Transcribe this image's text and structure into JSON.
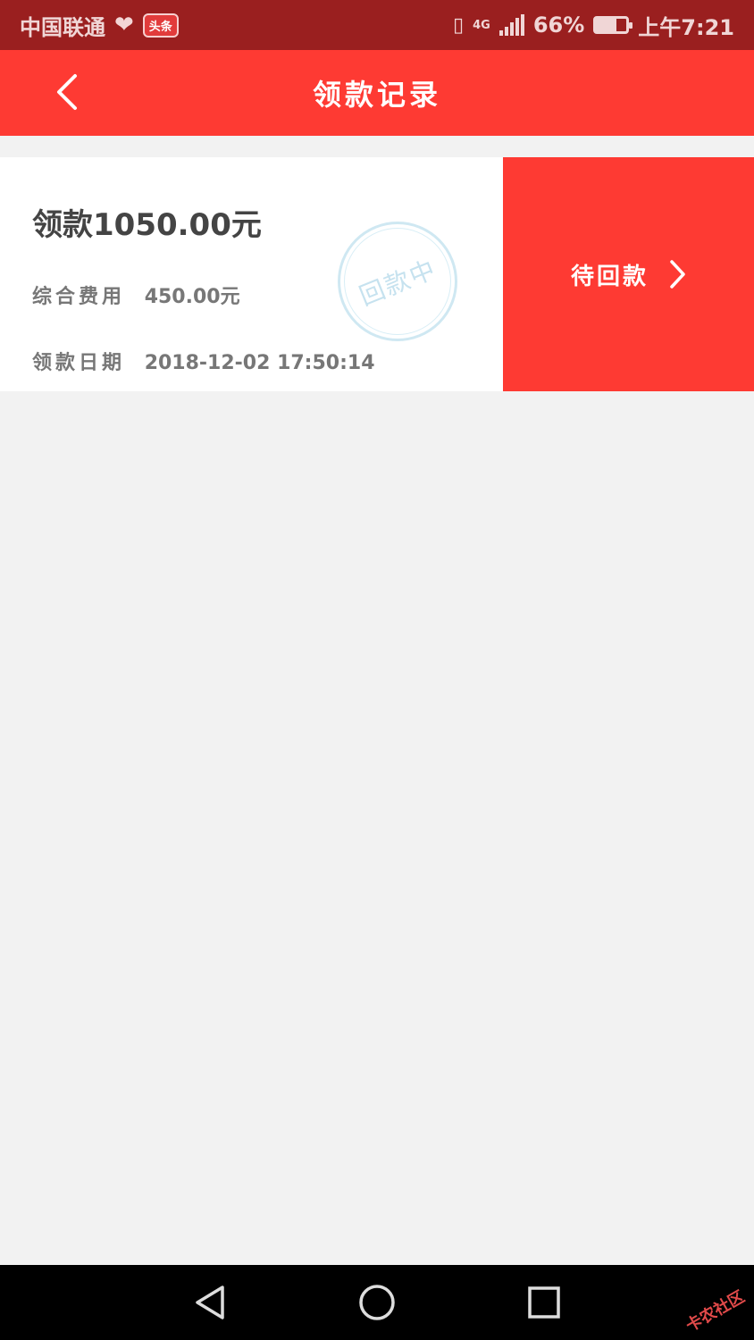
{
  "status_bar": {
    "carrier": "中国联通",
    "badge": "头条",
    "network": "4G",
    "battery": "66%",
    "battery_level": 0.66,
    "time": "上午7:21"
  },
  "header": {
    "title": "领款记录",
    "back_icon": "chevron-left-icon"
  },
  "record": {
    "amount": "领款1050.00元",
    "fee_label": "综合费用",
    "fee_value": "450.00元",
    "date_label": "领款日期",
    "date_value": "2018-12-02 17:50:14",
    "stamp": "回款中",
    "action_label": "待回款",
    "action_icon": "chevron-right-icon"
  },
  "nav": {
    "back_icon": "triangle-back-icon",
    "home_icon": "circle-home-icon",
    "recent_icon": "square-recent-icon"
  },
  "watermark": "卡农社区",
  "colors": {
    "primary": "#fe3a33",
    "status_bar": "#9a1f1f",
    "background": "#f2f2f2"
  }
}
